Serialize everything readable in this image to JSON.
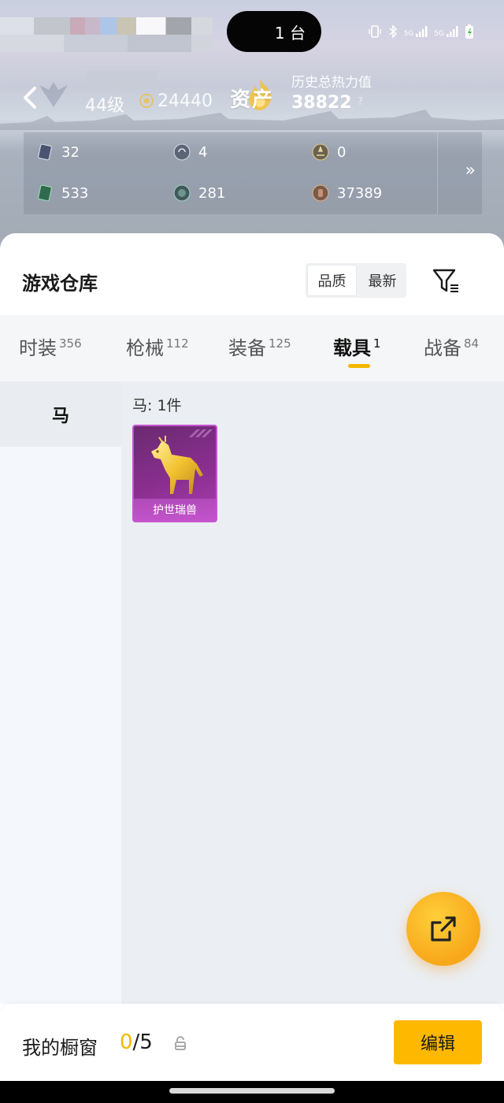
{
  "status_bar": {
    "pill_text": "1 台",
    "signal_1": "5G",
    "signal_2": "5G"
  },
  "profile": {
    "level": "44级",
    "coins": "24440"
  },
  "assets": {
    "label": "资产",
    "history_label": "历史总热力值",
    "history_value": "38822",
    "help": "?"
  },
  "stats": [
    {
      "icon": "card-icon",
      "value": "32"
    },
    {
      "icon": "badge-icon",
      "value": "4"
    },
    {
      "icon": "medal-icon",
      "value": "0"
    },
    {
      "icon": "ticket-icon",
      "value": "533"
    },
    {
      "icon": "orb-icon",
      "value": "281"
    },
    {
      "icon": "bronze-coin-icon",
      "value": "37389"
    }
  ],
  "more_arrow": "»",
  "warehouse": {
    "title": "游戏仓库",
    "sort_options": [
      "品质",
      "最新"
    ],
    "sort_selected": "品质"
  },
  "tabs": [
    {
      "label": "时装",
      "count": "356"
    },
    {
      "label": "枪械",
      "count": "112"
    },
    {
      "label": "装备",
      "count": "125"
    },
    {
      "label": "载具",
      "count": "1"
    },
    {
      "label": "战备",
      "count": "84"
    }
  ],
  "active_tab": "载具",
  "sidebar": {
    "items": [
      {
        "label": "马"
      }
    ]
  },
  "content": {
    "count_label": "马: 1件",
    "items": [
      {
        "name": "护世瑞兽",
        "quality_color": "#a83cae"
      }
    ]
  },
  "showcase": {
    "label": "我的橱窗",
    "current": "0",
    "total": "/5",
    "edit_label": "编辑"
  },
  "colors": {
    "accent": "#ffb800",
    "tab_indicator": "#f2b800",
    "item_purple": "#a83cae"
  }
}
